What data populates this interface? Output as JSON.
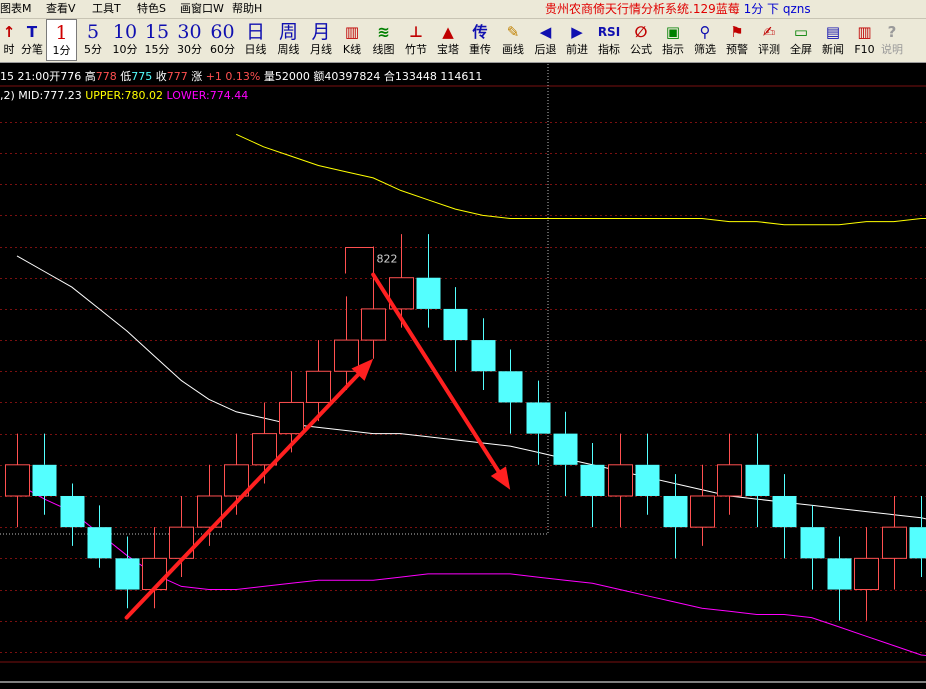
{
  "menubar": {
    "items": [
      "图表M",
      "查看V",
      "工具T",
      "特色S",
      "画窗口W",
      "帮助H"
    ],
    "title": "贵州农商倚天行情分析系统.129蓝莓",
    "subtitle": "1分 下 qzns"
  },
  "toolbar": {
    "buttons": [
      {
        "id": "tick",
        "glyph": "↑",
        "label": "时",
        "kind": "tool",
        "color": "#c00000"
      },
      {
        "id": "fenbi",
        "glyph": "T",
        "label": "分笔",
        "kind": "tool",
        "color": "#1010b0"
      },
      {
        "id": "p1",
        "glyph": "1",
        "label": "1分",
        "kind": "period",
        "active": true
      },
      {
        "id": "p5",
        "glyph": "5",
        "label": "5分",
        "kind": "period"
      },
      {
        "id": "p10",
        "glyph": "10",
        "label": "10分",
        "kind": "period"
      },
      {
        "id": "p15",
        "glyph": "15",
        "label": "15分",
        "kind": "period"
      },
      {
        "id": "p30",
        "glyph": "30",
        "label": "30分",
        "kind": "period"
      },
      {
        "id": "p60",
        "glyph": "60",
        "label": "60分",
        "kind": "period"
      },
      {
        "id": "pd",
        "glyph": "日",
        "label": "日线",
        "kind": "period"
      },
      {
        "id": "pw",
        "glyph": "周",
        "label": "周线",
        "kind": "period"
      },
      {
        "id": "pm",
        "glyph": "月",
        "label": "月线",
        "kind": "period"
      },
      {
        "id": "kline",
        "glyph": "▥",
        "label": "K线",
        "kind": "tool",
        "color": "#c00000"
      },
      {
        "id": "xiantu",
        "glyph": "≋",
        "label": "线图",
        "kind": "tool",
        "color": "#008000"
      },
      {
        "id": "zhujie",
        "glyph": "⊥",
        "label": "竹节",
        "kind": "tool",
        "color": "#c00000"
      },
      {
        "id": "baota",
        "glyph": "▲",
        "label": "宝塔",
        "kind": "tool",
        "color": "#c00000"
      },
      {
        "id": "zhongchuan",
        "glyph": "传",
        "label": "重传",
        "kind": "tool",
        "color": "#1010b0"
      },
      {
        "id": "huaxian",
        "glyph": "✎",
        "label": "画线",
        "kind": "tool",
        "color": "#c08000"
      },
      {
        "id": "houtui",
        "glyph": "◀",
        "label": "后退",
        "kind": "tool",
        "color": "#1010b0"
      },
      {
        "id": "qianjin",
        "glyph": "▶",
        "label": "前进",
        "kind": "tool",
        "color": "#1010b0"
      },
      {
        "id": "zhibiao",
        "glyph": "RSI",
        "label": "指标",
        "kind": "tool",
        "color": "#1010b0"
      },
      {
        "id": "gongshi",
        "glyph": "∅",
        "label": "公式",
        "kind": "tool",
        "color": "#c00000"
      },
      {
        "id": "zhishi",
        "glyph": "▣",
        "label": "指示",
        "kind": "tool",
        "color": "#008000"
      },
      {
        "id": "shaixuan",
        "glyph": "⚲",
        "label": "筛选",
        "kind": "tool",
        "color": "#1010b0"
      },
      {
        "id": "yujing",
        "glyph": "⚑",
        "label": "预警",
        "kind": "tool",
        "color": "#c00000"
      },
      {
        "id": "pingce",
        "glyph": "✍",
        "label": "评测",
        "kind": "tool",
        "color": "#c00000"
      },
      {
        "id": "quanping",
        "glyph": "▭",
        "label": "全屏",
        "kind": "tool",
        "color": "#008000"
      },
      {
        "id": "xinwen",
        "glyph": "▤",
        "label": "新闻",
        "kind": "tool",
        "color": "#1010b0"
      },
      {
        "id": "f10",
        "glyph": "▥",
        "label": "F10",
        "kind": "tool",
        "color": "#c00000"
      },
      {
        "id": "shuoming",
        "glyph": "?",
        "label": "说明",
        "kind": "tool",
        "color": "#9a9a9a",
        "disabled": true
      }
    ]
  },
  "quote": {
    "prefix": "15 21:00",
    "open_label": "开",
    "open": "776",
    "high_label": "高",
    "high": "778",
    "low_label": "低",
    "low": "775",
    "close_label": "收",
    "close": "777",
    "change_label": "涨",
    "change": "+1",
    "change_pct": "0.13%",
    "volume_label": "量",
    "volume": "52000",
    "amount_label": "额",
    "amount": "40397824",
    "oi_label": "合",
    "oi": "133448",
    "extra": "114611"
  },
  "indicator": {
    "params": ",2)",
    "mid_label": "MID:",
    "mid": "777.23",
    "upper_label": "UPPER:",
    "upper": "780.02",
    "lower_label": "LOWER:",
    "lower": "774.44"
  },
  "colors": {
    "bg": "#000000",
    "up": "#ff5050",
    "down": "#54ffff",
    "mid": "#ffffff",
    "upper": "#ffff00",
    "lower": "#ff00ff",
    "arrow": "#ff2020",
    "grid": "#7a1010",
    "label": "#d0d0d0"
  },
  "chart_data": {
    "type": "candlestick",
    "title": "",
    "indicator": "BOLL",
    "high_marker": "822",
    "ylim": [
      812.5,
      830.3
    ],
    "candles": [
      {
        "o": 817.6,
        "c": 818.6,
        "h": 819.6,
        "l": 816.6
      },
      {
        "o": 818.6,
        "c": 817.6,
        "h": 819.6,
        "l": 817.0
      },
      {
        "o": 817.6,
        "c": 816.6,
        "h": 818.0,
        "l": 816.0
      },
      {
        "o": 816.6,
        "c": 815.6,
        "h": 817.3,
        "l": 815.3
      },
      {
        "o": 815.6,
        "c": 814.6,
        "h": 816.3,
        "l": 814.0
      },
      {
        "o": 814.6,
        "c": 815.6,
        "h": 816.6,
        "l": 814.0
      },
      {
        "o": 815.6,
        "c": 816.6,
        "h": 817.6,
        "l": 815.0
      },
      {
        "o": 816.6,
        "c": 817.6,
        "h": 818.6,
        "l": 816.0
      },
      {
        "o": 817.6,
        "c": 818.6,
        "h": 819.6,
        "l": 817.0
      },
      {
        "o": 818.6,
        "c": 819.6,
        "h": 820.6,
        "l": 818.0
      },
      {
        "o": 819.6,
        "c": 820.6,
        "h": 821.6,
        "l": 819.0
      },
      {
        "o": 820.6,
        "c": 821.6,
        "h": 822.6,
        "l": 820.0
      },
      {
        "o": 821.6,
        "c": 822.6,
        "h": 824.0,
        "l": 821.0
      },
      {
        "o": 822.6,
        "c": 823.6,
        "h": 825.6,
        "l": 822.0
      },
      {
        "o": 823.6,
        "c": 824.6,
        "h": 826.0,
        "l": 823.0
      },
      {
        "o": 824.6,
        "c": 823.6,
        "h": 826.0,
        "l": 823.0
      },
      {
        "o": 823.6,
        "c": 822.6,
        "h": 824.3,
        "l": 821.6
      },
      {
        "o": 822.6,
        "c": 821.6,
        "h": 823.3,
        "l": 821.0
      },
      {
        "o": 821.6,
        "c": 820.6,
        "h": 822.3,
        "l": 819.6
      },
      {
        "o": 820.6,
        "c": 819.6,
        "h": 821.3,
        "l": 818.6
      },
      {
        "o": 819.6,
        "c": 818.6,
        "h": 820.3,
        "l": 817.6
      },
      {
        "o": 818.6,
        "c": 817.6,
        "h": 819.3,
        "l": 816.6
      },
      {
        "o": 817.6,
        "c": 818.6,
        "h": 819.6,
        "l": 816.6
      },
      {
        "o": 818.6,
        "c": 817.6,
        "h": 819.6,
        "l": 817.0
      },
      {
        "o": 817.6,
        "c": 816.6,
        "h": 818.3,
        "l": 815.6
      },
      {
        "o": 816.6,
        "c": 817.6,
        "h": 818.6,
        "l": 816.0
      },
      {
        "o": 817.6,
        "c": 818.6,
        "h": 819.6,
        "l": 817.0
      },
      {
        "o": 818.6,
        "c": 817.6,
        "h": 819.6,
        "l": 816.6
      },
      {
        "o": 817.6,
        "c": 816.6,
        "h": 818.3,
        "l": 815.6
      },
      {
        "o": 816.6,
        "c": 815.6,
        "h": 817.3,
        "l": 814.6
      },
      {
        "o": 815.6,
        "c": 814.6,
        "h": 816.3,
        "l": 813.6
      },
      {
        "o": 814.6,
        "c": 815.6,
        "h": 816.6,
        "l": 813.6
      },
      {
        "o": 815.6,
        "c": 816.6,
        "h": 817.6,
        "l": 814.6
      },
      {
        "o": 816.6,
        "c": 815.6,
        "h": 817.6,
        "l": 815.0
      },
      {
        "o": 815.6,
        "c": 816.6,
        "h": 817.6,
        "l": 814.6
      },
      {
        "o": 816.6,
        "c": 814.6,
        "h": 817.6,
        "l": 814.0
      },
      {
        "o": 814.6,
        "c": 813.6,
        "h": 815.3,
        "l": 812.6
      }
    ],
    "mid": [
      825.3,
      824.8,
      824.3,
      823.6,
      822.9,
      822.1,
      821.3,
      820.7,
      820.3,
      820.1,
      819.9,
      819.8,
      819.7,
      819.6,
      819.6,
      819.5,
      819.4,
      819.3,
      819.2,
      819.0,
      818.8,
      818.6,
      818.4,
      818.2,
      818.0,
      817.8,
      817.6,
      817.5,
      817.4,
      817.3,
      817.2,
      817.1,
      817.0,
      816.9,
      816.7,
      816.5,
      816.3
    ],
    "upper": [
      null,
      null,
      null,
      null,
      null,
      null,
      null,
      null,
      829.2,
      828.8,
      828.5,
      828.2,
      828.0,
      827.8,
      827.4,
      827.1,
      826.8,
      826.6,
      826.5,
      826.5,
      826.5,
      826.5,
      826.5,
      826.5,
      826.5,
      826.5,
      826.4,
      826.4,
      826.3,
      826.3,
      826.3,
      826.4,
      826.4,
      826.5,
      826.5,
      826.5,
      826.5
    ],
    "lower": [
      818.0,
      817.5,
      817.1,
      816.4,
      815.7,
      815.1,
      814.7,
      814.6,
      814.6,
      814.7,
      814.8,
      814.9,
      814.9,
      814.9,
      815.0,
      815.1,
      815.1,
      815.1,
      815.1,
      815.0,
      814.9,
      814.8,
      814.6,
      814.4,
      814.2,
      814.0,
      813.9,
      813.8,
      813.8,
      813.7,
      813.4,
      813.1,
      812.8,
      812.5,
      812.4,
      812.2,
      811.6
    ]
  },
  "annotations": {
    "arrows": [
      {
        "name": "up-arrow",
        "from": {
          "i": 4,
          "v": 813.7
        },
        "to": {
          "i": 13,
          "v": 822.0
        }
      },
      {
        "name": "down-arrow",
        "from": {
          "i": 13,
          "v": 824.7
        },
        "to": {
          "i": 18,
          "v": 817.8
        }
      }
    ]
  }
}
